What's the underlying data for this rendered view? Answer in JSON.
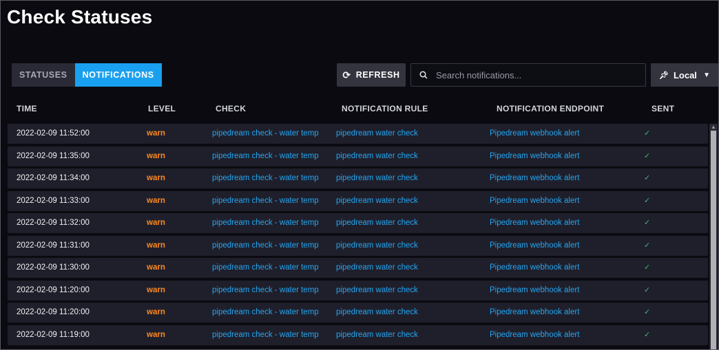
{
  "page": {
    "title": "Check Statuses"
  },
  "tabs": [
    {
      "label": "STATUSES",
      "active": false
    },
    {
      "label": "NOTIFICATIONS",
      "active": true
    }
  ],
  "toolbar": {
    "refresh_label": "REFRESH",
    "refresh_icon": "refresh-icon",
    "search_placeholder": "Search notifications...",
    "search_value": "",
    "timezone_label": "Local",
    "timezone_icon": "pin-icon"
  },
  "table": {
    "columns": [
      "TIME",
      "LEVEL",
      "CHECK",
      "NOTIFICATION RULE",
      "NOTIFICATION ENDPOINT",
      "SENT"
    ],
    "rows": [
      {
        "time": "2022-02-09 11:52:00",
        "level": "warn",
        "check": "pipedream check - water temp",
        "rule": "pipedream water check",
        "endpoint": "Pipedream webhook alert",
        "sent": "✓"
      },
      {
        "time": "2022-02-09 11:35:00",
        "level": "warn",
        "check": "pipedream check - water temp",
        "rule": "pipedream water check",
        "endpoint": "Pipedream webhook alert",
        "sent": "✓"
      },
      {
        "time": "2022-02-09 11:34:00",
        "level": "warn",
        "check": "pipedream check - water temp",
        "rule": "pipedream water check",
        "endpoint": "Pipedream webhook alert",
        "sent": "✓"
      },
      {
        "time": "2022-02-09 11:33:00",
        "level": "warn",
        "check": "pipedream check - water temp",
        "rule": "pipedream water check",
        "endpoint": "Pipedream webhook alert",
        "sent": "✓"
      },
      {
        "time": "2022-02-09 11:32:00",
        "level": "warn",
        "check": "pipedream check - water temp",
        "rule": "pipedream water check",
        "endpoint": "Pipedream webhook alert",
        "sent": "✓"
      },
      {
        "time": "2022-02-09 11:31:00",
        "level": "warn",
        "check": "pipedream check - water temp",
        "rule": "pipedream water check",
        "endpoint": "Pipedream webhook alert",
        "sent": "✓"
      },
      {
        "time": "2022-02-09 11:30:00",
        "level": "warn",
        "check": "pipedream check - water temp",
        "rule": "pipedream water check",
        "endpoint": "Pipedream webhook alert",
        "sent": "✓"
      },
      {
        "time": "2022-02-09 11:20:00",
        "level": "warn",
        "check": "pipedream check - water temp",
        "rule": "pipedream water check",
        "endpoint": "Pipedream webhook alert",
        "sent": "✓"
      },
      {
        "time": "2022-02-09 11:20:00",
        "level": "warn",
        "check": "pipedream check - water temp",
        "rule": "pipedream water check",
        "endpoint": "Pipedream webhook alert",
        "sent": "✓"
      },
      {
        "time": "2022-02-09 11:19:00",
        "level": "warn",
        "check": "pipedream check - water temp",
        "rule": "pipedream water check",
        "endpoint": "Pipedream webhook alert",
        "sent": "✓"
      }
    ]
  },
  "colors": {
    "accent": "#1aa0f0",
    "warn": "#ff8a1e",
    "link": "#24a6f2",
    "sent": "#3dbb77"
  }
}
